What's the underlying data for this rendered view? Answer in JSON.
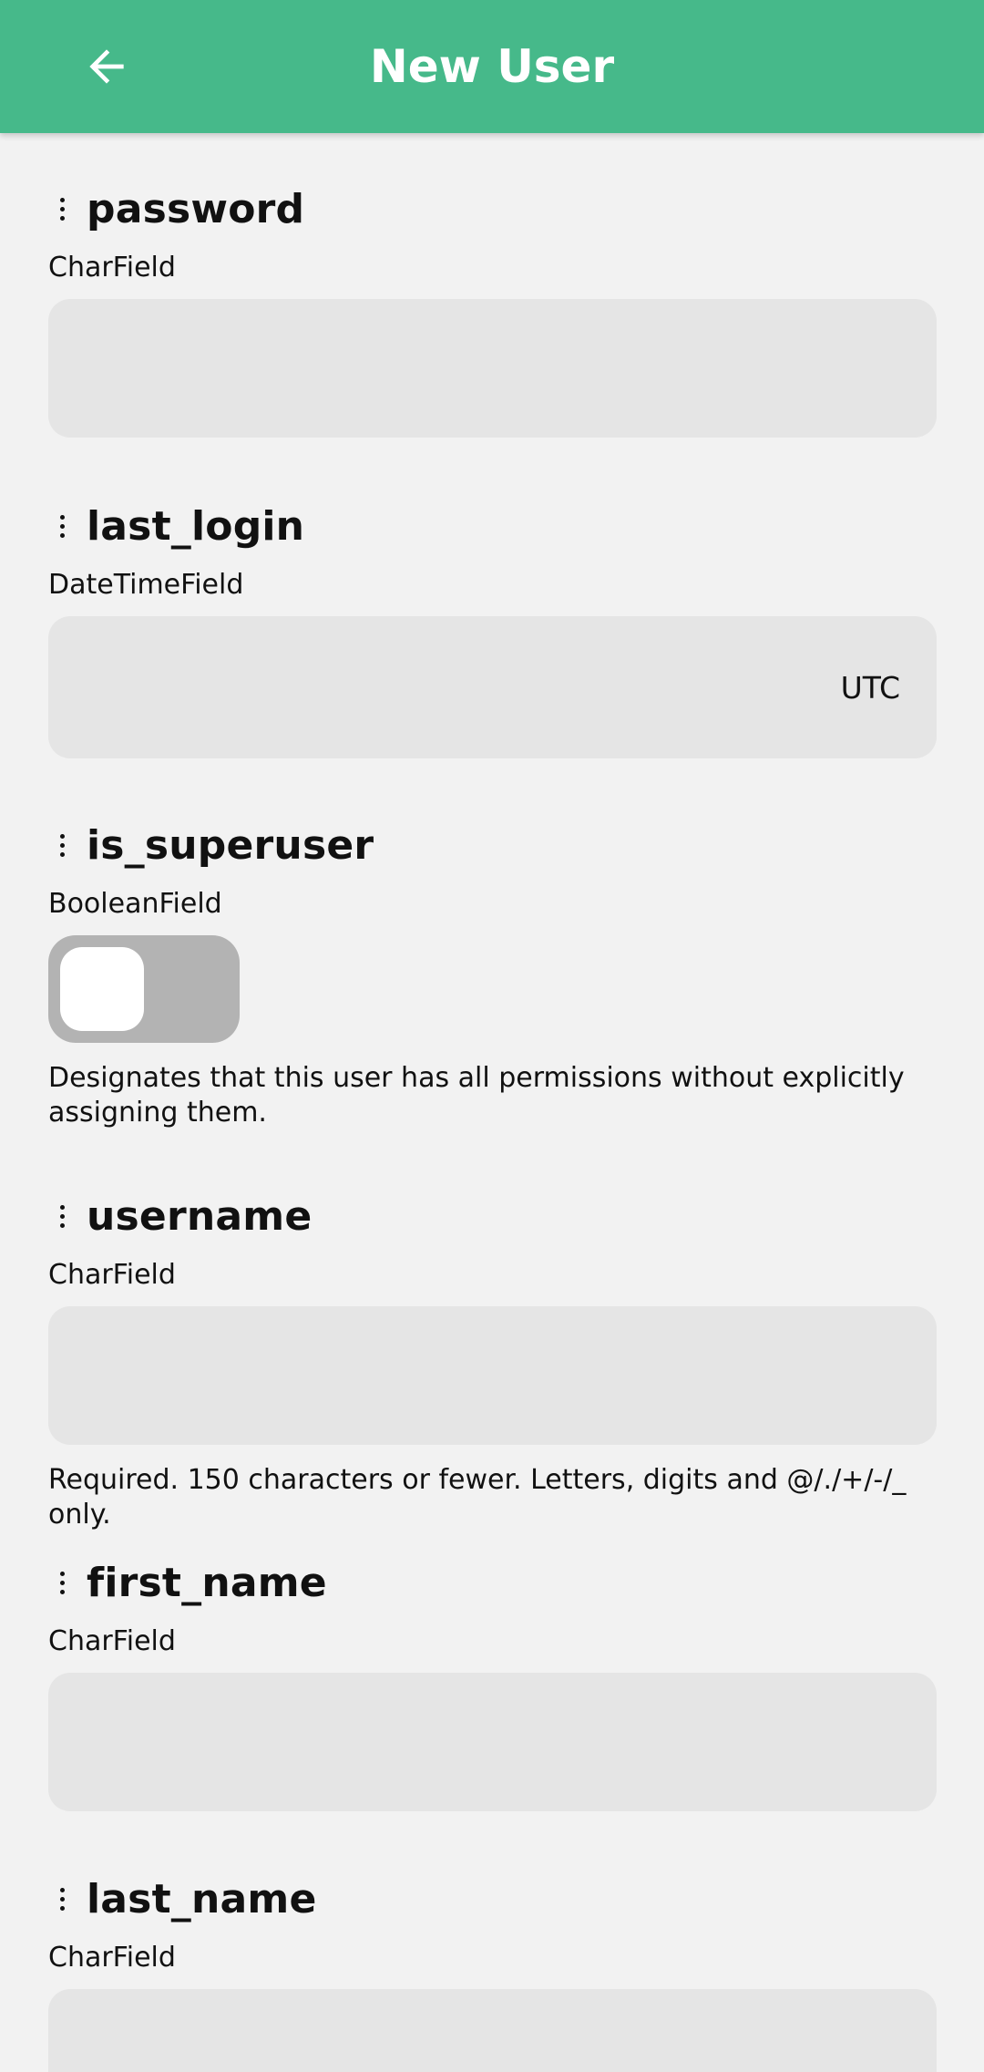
{
  "appbar": {
    "title": "New User",
    "back_icon": "arrow-left-icon"
  },
  "colors": {
    "appbar": "#46b98a",
    "background": "#f2f2f2",
    "input": "#e5e5e5",
    "toggle_off": "#b3b3b3"
  },
  "fields": [
    {
      "name": "password",
      "type": "CharField",
      "value": ""
    },
    {
      "name": "last_login",
      "type": "DateTimeField",
      "value": "",
      "suffix": "UTC"
    },
    {
      "name": "is_superuser",
      "type": "BooleanField",
      "checked": false,
      "help": "Designates that this user has all permissions without explicitly assigning them."
    },
    {
      "name": "username",
      "type": "CharField",
      "value": "",
      "help": "Required. 150 characters or fewer. Letters, digits and @/./+/-/_ only."
    },
    {
      "name": "first_name",
      "type": "CharField",
      "value": ""
    },
    {
      "name": "last_name",
      "type": "CharField",
      "value": ""
    }
  ]
}
